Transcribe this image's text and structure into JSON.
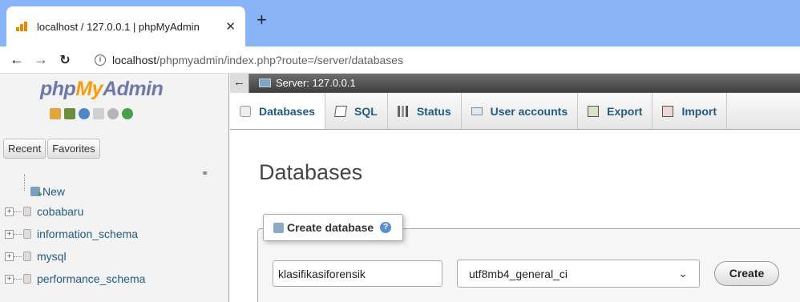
{
  "browser": {
    "tab_title": "localhost / 127.0.0.1 | phpMyAdmin",
    "tab_close": "✕",
    "new_tab": "+",
    "url_host": "localhost",
    "url_path": "/phpmyadmin/index.php?route=/server/databases"
  },
  "sidebar": {
    "logo_php": "php",
    "logo_my": "My",
    "logo_admin": "Admin",
    "tabs": [
      "Recent",
      "Favorites"
    ],
    "tree": [
      {
        "label": "New"
      },
      {
        "label": "cobabaru"
      },
      {
        "label": "information_schema"
      },
      {
        "label": "mysql"
      },
      {
        "label": "performance_schema"
      }
    ]
  },
  "main": {
    "server_label": "Server: 127.0.0.1",
    "tabs": [
      {
        "label": "Databases",
        "icon": "database-icon"
      },
      {
        "label": "SQL",
        "icon": "sql-icon"
      },
      {
        "label": "Status",
        "icon": "status-icon"
      },
      {
        "label": "User accounts",
        "icon": "users-icon"
      },
      {
        "label": "Export",
        "icon": "export-icon"
      },
      {
        "label": "Import",
        "icon": "import-icon"
      }
    ],
    "page_title": "Databases",
    "create_legend": "Create database",
    "db_name_value": "klasifikasiforensik",
    "collation_value": "utf8mb4_general_ci",
    "create_button": "Create"
  },
  "colors": {
    "browser_tabbar": "#8ab4f8",
    "pma_link": "#235a81",
    "logo_blue": "#6c78af",
    "logo_orange": "#f89c0e"
  }
}
